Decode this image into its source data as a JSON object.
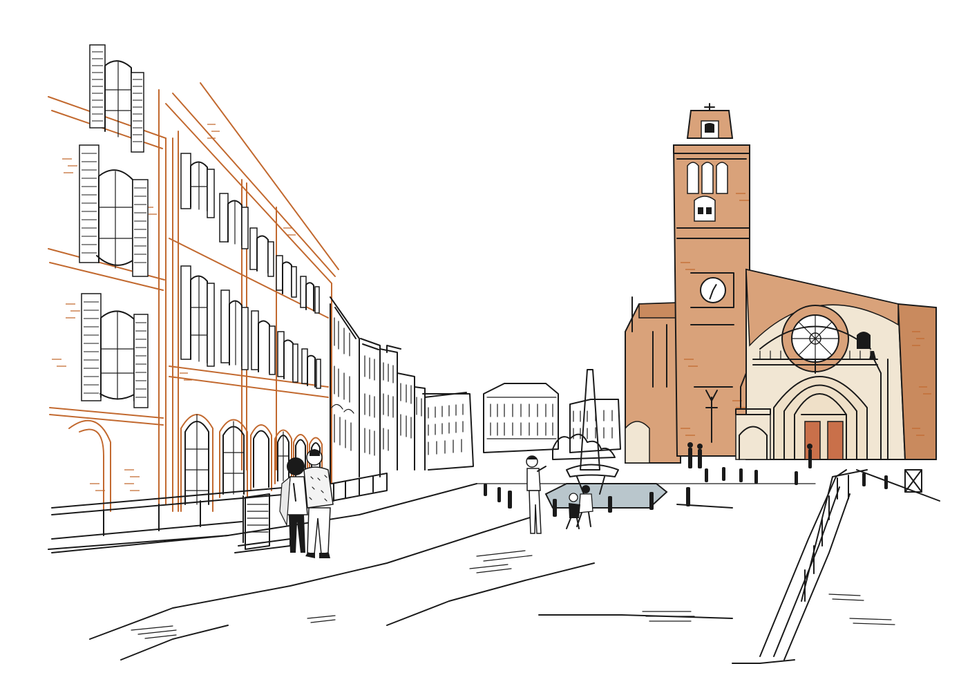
{
  "scene": {
    "kind": "pen-and-ink illustration",
    "palette": {
      "ink": "#1a1a1a",
      "terracotta": "#d9a27a",
      "terracotta_dark": "#c98a5e",
      "brick_line": "#c2692f",
      "stone": "#f1e6d3",
      "door": "#c9704a",
      "water": "#b9c6cc",
      "paper": "#ffffff"
    },
    "clock_face": {
      "hour_hand_deg": 30,
      "minute_hand_deg": 200
    }
  }
}
